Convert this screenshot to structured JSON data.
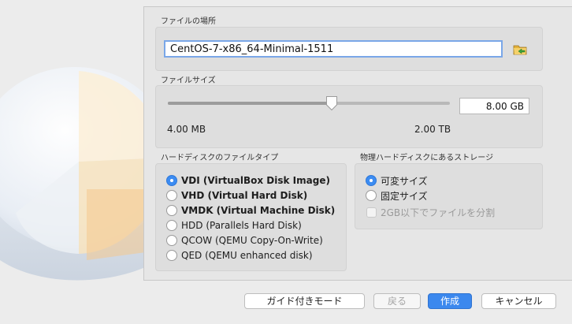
{
  "file_location": {
    "label": "ファイルの場所",
    "value": "CentOS-7-x86_64-Minimal-1511",
    "folder_icon": "folder-green-arrow-icon"
  },
  "file_size": {
    "label": "ファイルサイズ",
    "value": "8.00 GB",
    "min_label": "4.00 MB",
    "max_label": "2.00 TB",
    "slider_position": 0.58
  },
  "disk_type": {
    "label": "ハードディスクのファイルタイプ",
    "options": [
      {
        "label": "VDI (VirtualBox Disk Image)",
        "selected": true
      },
      {
        "label": "VHD (Virtual Hard Disk)",
        "selected": false
      },
      {
        "label": "VMDK (Virtual Machine Disk)",
        "selected": false
      },
      {
        "label": "HDD (Parallels Hard Disk)",
        "selected": false
      },
      {
        "label": "QCOW (QEMU Copy-On-Write)",
        "selected": false
      },
      {
        "label": "QED (QEMU enhanced disk)",
        "selected": false
      }
    ]
  },
  "storage": {
    "label": "物理ハードディスクにあるストレージ",
    "options": [
      {
        "label": "可変サイズ",
        "selected": true
      },
      {
        "label": "固定サイズ",
        "selected": false
      }
    ],
    "split_checkbox": {
      "label": "2GB以下でファイルを分割",
      "checked": false,
      "enabled": false
    }
  },
  "buttons": {
    "guided_mode": "ガイド付きモード",
    "back": "戻る",
    "create": "作成",
    "cancel": "キャンセル"
  },
  "colors": {
    "accent": "#3b88ee",
    "panel_bg": "#e6e6e6"
  }
}
